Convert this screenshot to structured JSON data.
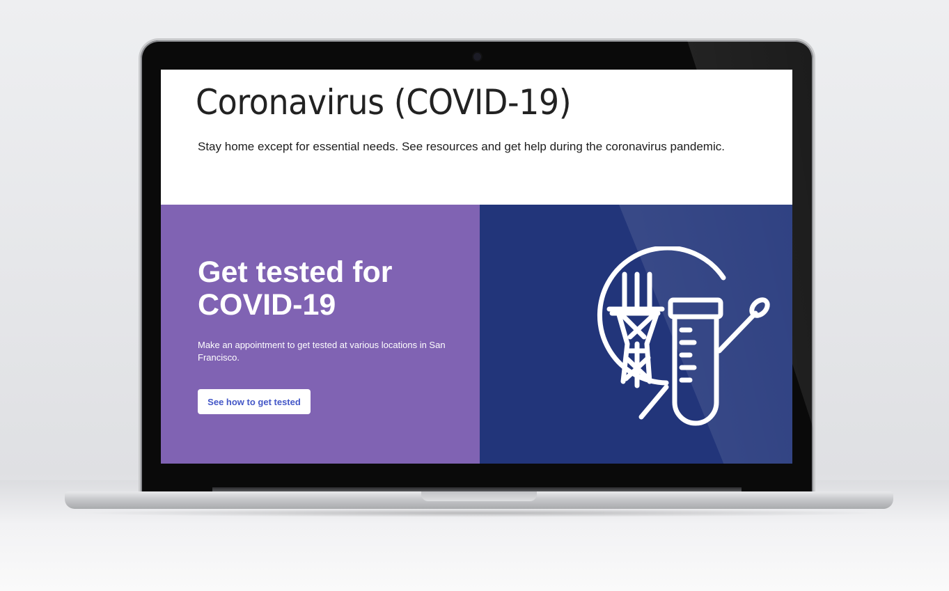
{
  "page": {
    "title": "Coronavirus (COVID-19)",
    "subtitle": "Stay home except for essential needs. See resources and get help during the coronavirus pandemic."
  },
  "hero": {
    "title": "Get tested for COVID-19",
    "description": "Make an appointment to get tested at various locations in San Francisco.",
    "button_label": "See how to get tested",
    "illustration_icon": "sutro-tower-test-tube-swab-icon"
  },
  "colors": {
    "hero_left_bg": "#8063b3",
    "hero_right_bg": "#22357a",
    "button_text": "#4457c7"
  }
}
